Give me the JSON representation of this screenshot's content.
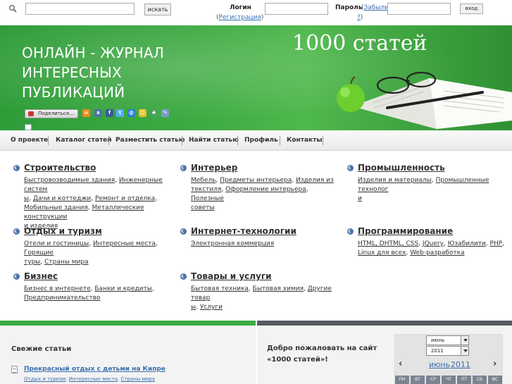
{
  "topbar": {
    "search_button": "искать",
    "login_label": "Логин",
    "register_link": "Регистрация",
    "password_label": "Пароль",
    "forgot_link_part1": "Забыли",
    "forgot_link_part2": "?",
    "enter_button": "вход"
  },
  "banner": {
    "title_line1": "ОНЛАЙН - ЖУРНАЛ",
    "title_line2": "ИНТЕРЕСНЫХ",
    "title_line3": "ПУБЛИКАЦИЙ",
    "logo": "1000 статей",
    "share_label": "Поделиться..."
  },
  "nav": {
    "items": [
      "О проекте",
      "Каталог статей",
      "Разместить статью",
      "Найти статью",
      "Профиль",
      "Контакты"
    ]
  },
  "categories": [
    {
      "title": "Строительство",
      "links": [
        "Быстровозводимые здания",
        "Инженерные систем",
        "ы",
        "Дачи и коттеджи",
        "Ремонт и отделка",
        "Мобильные здания",
        "Металлические конструкции",
        "и изделия"
      ]
    },
    {
      "title": "Интерьер",
      "links": [
        "Мебель",
        "Предметы интерьера",
        "Изделия из",
        "текстиля",
        "Оформление интерьера",
        "Полезные",
        "советы"
      ]
    },
    {
      "title": "Промышленность",
      "links": [
        "Изделия и материалы",
        "Промышленные технолог",
        "и"
      ]
    },
    {
      "title": "Отдых и туризм",
      "links": [
        "Отели и гостиницы",
        "Интересные места",
        "Горящие",
        "туры",
        "Страны мира"
      ]
    },
    {
      "title": "Интернет-технологии",
      "links": [
        "Электронная коммерция"
      ]
    },
    {
      "title": "Программирование",
      "links": [
        "HTML, DHTML, CSS",
        "JQuery",
        "Юзабилити",
        "PHP",
        "Linux для всех",
        "Web-разработка"
      ]
    },
    {
      "title": "Бизнес",
      "links": [
        "Бизнес в интернете",
        "Банки и кредиты",
        "Предпринимательство"
      ]
    },
    {
      "title": "Товары и услуги",
      "links": [
        "Бытовая техника",
        "Бытовая химия",
        "Другие товар",
        "ы",
        "Услуги"
      ]
    }
  ],
  "fresh": {
    "title": "Свежие статьи",
    "article_title": "Прекрасный отдых с детьми на Кипре",
    "tags": [
      "Отдых и туризм",
      "Интересные места",
      "Страны мира"
    ]
  },
  "welcome": {
    "line1": "Добро пожаловать на сайт",
    "line2": "«1000 статей»!"
  },
  "calendar": {
    "month_select": "июнь",
    "year_select": "2011",
    "month_link": "июнь",
    "year_link": "2011",
    "prev": "‹",
    "next": "›",
    "weekdays": [
      "ПН",
      "ВТ",
      "СР",
      "ЧТ",
      "ПТ",
      "СБ",
      "ВС"
    ]
  },
  "colors": {
    "banner_green": "#3eab43",
    "link_blue": "#3b6fb0",
    "strip_green": "#3daa3f",
    "strip_gray": "#555b62"
  }
}
